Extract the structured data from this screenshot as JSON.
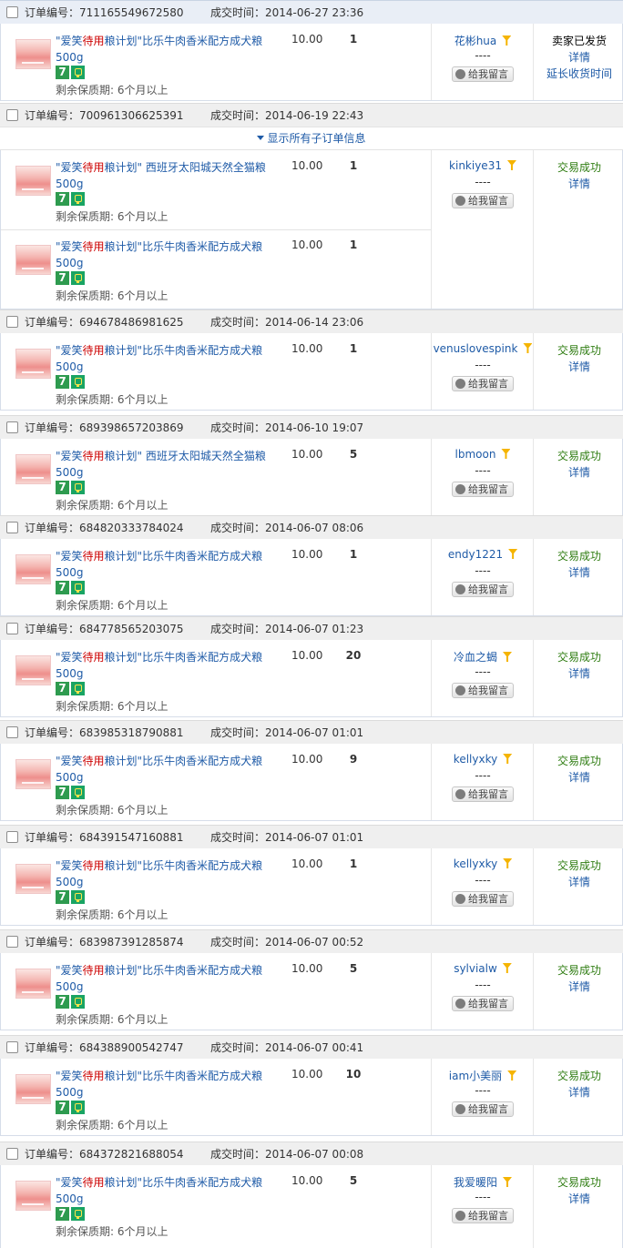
{
  "labels": {
    "order_no": "订单编号：",
    "deal_time": "成交时间：",
    "shelf_life": "剩余保质期: 6个月以上",
    "leave_message": "给我留言",
    "detail": "详情",
    "extend": "延长收货时间",
    "expand_all": "显示所有子订单信息",
    "dash": "----"
  },
  "orders": [
    {
      "id": "711165549672580",
      "time": "2014-06-27 23:36",
      "seller": "花彬hua",
      "status": "卖家已发货",
      "extend": true,
      "items": [
        {
          "product": "dog",
          "qty": "1",
          "price": "10.00"
        }
      ]
    },
    {
      "id": "700961306625391",
      "time": "2014-06-19 22:43",
      "seller": "kinkiye31",
      "status": "交易成功",
      "expandable": true,
      "items": [
        {
          "product": "cat",
          "qty": "1",
          "price": "10.00"
        },
        {
          "product": "dog",
          "qty": "1",
          "price": "10.00"
        }
      ]
    },
    {
      "id": "694678486981625",
      "time": "2014-06-14 23:06",
      "seller": "venuslovespink",
      "status": "交易成功",
      "items": [
        {
          "product": "dog",
          "qty": "1",
          "price": "10.00"
        }
      ]
    },
    {
      "id": "689398657203869",
      "time": "2014-06-10 19:07",
      "seller": "lbmoon",
      "status": "交易成功",
      "items": [
        {
          "product": "cat",
          "qty": "5",
          "price": "10.00"
        }
      ]
    },
    {
      "id": "684820333784024",
      "time": "2014-06-07 08:06",
      "seller": "endy1221",
      "status": "交易成功",
      "items": [
        {
          "product": "dog",
          "qty": "1",
          "price": "10.00"
        }
      ]
    },
    {
      "id": "684778565203075",
      "time": "2014-06-07 01:23",
      "seller": "冷血之蝎",
      "status": "交易成功",
      "items": [
        {
          "product": "dog",
          "qty": "20",
          "price": "10.00"
        }
      ]
    },
    {
      "id": "683985318790881",
      "time": "2014-06-07 01:01",
      "seller": "kellyxky",
      "status": "交易成功",
      "items": [
        {
          "product": "dog",
          "qty": "9",
          "price": "10.00"
        }
      ]
    },
    {
      "id": "684391547160881",
      "time": "2014-06-07 01:01",
      "seller": "kellyxky",
      "status": "交易成功",
      "items": [
        {
          "product": "dog",
          "qty": "1",
          "price": "10.00"
        }
      ]
    },
    {
      "id": "683987391285874",
      "time": "2014-06-07 00:52",
      "seller": "sylvialw",
      "status": "交易成功",
      "items": [
        {
          "product": "dog",
          "qty": "5",
          "price": "10.00"
        }
      ]
    },
    {
      "id": "684388900542747",
      "time": "2014-06-07 00:41",
      "seller": "iam小美丽",
      "status": "交易成功",
      "items": [
        {
          "product": "dog",
          "qty": "10",
          "price": "10.00"
        }
      ]
    },
    {
      "id": "684372821688054",
      "time": "2014-06-07 00:08",
      "seller": "我爱暖阳",
      "status": "交易成功",
      "items": [
        {
          "product": "dog",
          "qty": "5",
          "price": "10.00"
        }
      ]
    }
  ],
  "products": {
    "dog": {
      "pre": "\"爱笑",
      "red": "待用",
      "mid": "粮",
      "post": "计划\"比乐牛肉香米配方成犬粮 500g"
    },
    "cat": {
      "pre": "\"爱笑",
      "red": "待用",
      "mid": "粮",
      "post": "计划\" 西班牙太阳城天然全猫粮 500g"
    }
  },
  "colors": {
    "link": "#1f5ba7",
    "success": "#2f7d12",
    "red": "#cc0000"
  }
}
